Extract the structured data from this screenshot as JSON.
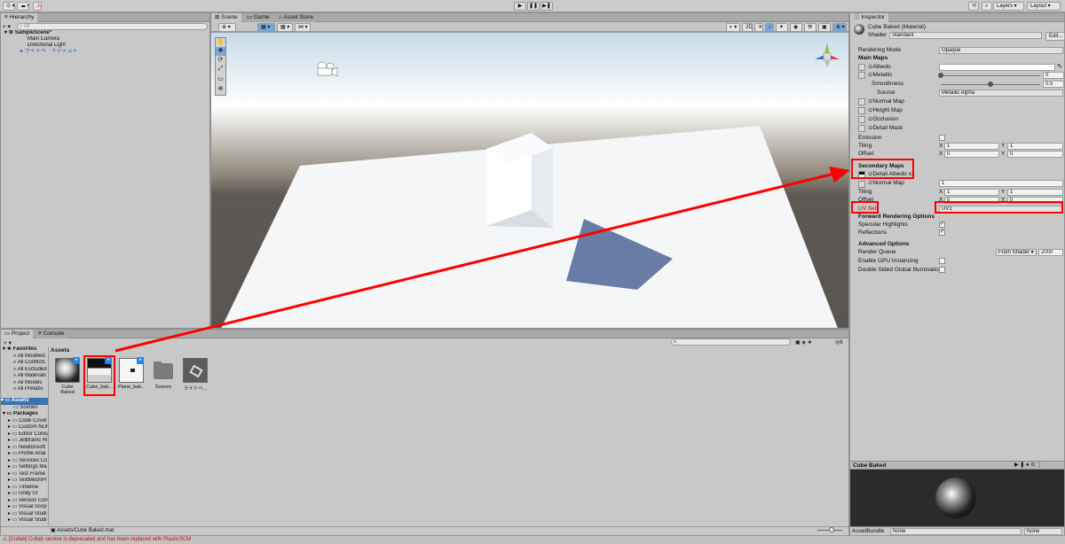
{
  "toolbar": {
    "account_label": "⊙ ▾",
    "cloud_label": "☁ ▾",
    "collab_label": "⚠",
    "play": "▶",
    "pause": "❚❚",
    "step": "▶❚",
    "history_icon": "⟲",
    "search_icon": "⌕",
    "layers_label": "Layers",
    "layout_label": "Layout"
  },
  "hierarchy": {
    "tab": "Hierarchy",
    "add": "+ ▾",
    "search_placeholder": "All",
    "scene": "SampleScene*",
    "items": [
      "Main Camera",
      "Directional Light",
      "ライトベ゛イクテスト"
    ]
  },
  "scene_view": {
    "tabs": [
      "Scene",
      "Game",
      "Asset Store"
    ],
    "shading_mode": "2D",
    "perspective_label": "< Persp",
    "tools": [
      "✋",
      "✥",
      "⟳",
      "⤢",
      "▭",
      "⊕"
    ]
  },
  "project": {
    "tabs": [
      "Project",
      "Console"
    ],
    "add": "+ ▾",
    "badge": "6",
    "favorites_label": "Favorites",
    "favorites": [
      "All Modified",
      "All Conflicts",
      "All Excluded",
      "All Materials",
      "All Models",
      "All Prefabs"
    ],
    "assets_label": "Assets",
    "asset_folders": [
      "Scenes"
    ],
    "packages_label": "Packages",
    "packages": [
      "Code Cover",
      "Custom NUr",
      "Editor Corou",
      "JetBrains Ri",
      "Newtonsoft",
      "Profile Anal",
      "Services Co",
      "Settings Ma",
      "Test Frame",
      "TextMeshPr",
      "Timeline",
      "Unity UI",
      "Version Con",
      "Visual Scrip",
      "Visual Studi",
      "Visual Studi"
    ],
    "breadcrumb": "Assets",
    "assets": [
      {
        "name": "Cube Baked",
        "kind": "material"
      },
      {
        "name": "Cube_bak...",
        "kind": "texture"
      },
      {
        "name": "Plane_bak...",
        "kind": "texture-light"
      },
      {
        "name": "Scenes",
        "kind": "folder"
      },
      {
        "name": "ライトベ...",
        "kind": "scene"
      }
    ],
    "footer_path": "Assets/Cube Baked.mat"
  },
  "inspector": {
    "tab": "Inspector",
    "title": "Cube Baked (Material)",
    "shader_label": "Shader",
    "shader_value": "Standard",
    "edit_label": "Edit...",
    "rendering_mode_label": "Rendering Mode",
    "rendering_mode_value": "Opaque",
    "main_maps": "Main Maps",
    "albedo": "Albedo",
    "metallic": "Metallic",
    "metallic_value": "0",
    "metallic_level": 0,
    "smoothness": "Smoothness",
    "smoothness_value": "0.5",
    "smoothness_level": 0.5,
    "source": "Source",
    "source_value": "Metallic Alpha",
    "normal_map": "Normal Map",
    "height_map": "Height Map",
    "occlusion": "Occlusion",
    "detail_mask": "Detail Mask",
    "emission": "Emission",
    "tiling": "Tiling",
    "offset": "Offset",
    "x_label": "X",
    "y_label": "Y",
    "tiling_x": "1",
    "tiling_y": "1",
    "offset_x": "0",
    "offset_y": "0",
    "secondary_maps": "Secondary Maps",
    "detail_albedo": "Detail Albedo x2",
    "sec_normal_map": "Normal Map",
    "sec_normal_value": "1",
    "sec_tiling_x": "1",
    "sec_tiling_y": "1",
    "sec_offset_x": "0",
    "sec_offset_y": "0",
    "uv_set_label": "UV Set",
    "uv_set_value": "UV1",
    "forward_options": "Forward Rendering Options",
    "specular": "Specular Highlights",
    "reflections": "Reflections",
    "advanced": "Advanced Options",
    "render_queue": "Render Queue",
    "render_queue_mode": "From Shader",
    "render_queue_value": "2000",
    "gpu_instancing": "Enable GPU Instancing",
    "double_sided": "Double Sided Global Illumination",
    "preview_title": "Cube Baked",
    "assetbundle_label": "AssetBundle",
    "assetbundle_value": "None",
    "assetbundle_variant": "None"
  },
  "status": {
    "message": "[Collab] Collab service is deprecated and has been replaced with PlasticSCM"
  },
  "colors": {
    "highlight": "#ff0000",
    "selection": "#3a72b0"
  }
}
